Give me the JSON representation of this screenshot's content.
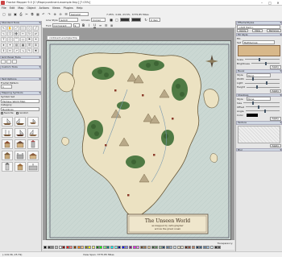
{
  "window": {
    "title": "Fractal Mapper 9.0 [C:\\Maps\\continent-example.fmp] [7.05%]",
    "minimize": "–",
    "maximize": "□",
    "close": "✕"
  },
  "menu": [
    "File",
    "Edit",
    "Map",
    "Object",
    "Actions",
    "Views",
    "Plugins",
    "Help"
  ],
  "toolbar": {
    "layer_select": "General",
    "zoom": "7.05%",
    "coords": "0.06, 23.5%",
    "distance": "3775.85 Miles",
    "line_style_label": "Line Style",
    "line_style_value": "(solid)",
    "arrows_label": "Arrows:",
    "arrows_value": "(none)",
    "font_label": "Font",
    "font_value": "Cormorant",
    "size_value": "9",
    "angle_value": "0 deg",
    "transparency_label": "Transparency:"
  },
  "left_panel": {
    "standard_tools": "Standard Tools",
    "tools": [
      "↖",
      "✋",
      "⤢",
      "⬜",
      "○",
      "╱",
      "∿",
      "⎔",
      "➕",
      "✂",
      "↻",
      "⇄",
      "T",
      "⬡",
      "⌒",
      "◇",
      "⚑",
      "☀",
      "★",
      "✦",
      "▧",
      "▩",
      "☰",
      "⊞",
      "⇕",
      "⇔",
      "↗",
      "↘",
      "✎",
      "✖"
    ],
    "grid_panel": "Grid Panel Tools",
    "custom_tools": "Custom Tools",
    "text_options": "Text Options",
    "fractal_pattern": "Fractal Pattern",
    "fractal_value": "1",
    "mapping_symbols": "Mapping Symbols",
    "symbol_set_label": "Symbol Set",
    "symbol_set": "Fantasy World Map",
    "category_label": "Category",
    "category": "Buildings",
    "favorite_label": "favorite",
    "random_label": "random"
  },
  "document": {
    "tab": "continent-example.fmp",
    "legend_title": "The Unseen World",
    "legend_sub1": "as mapped by cartographer",
    "legend_sub2": "across the great ocean"
  },
  "right_panel": {
    "effects_styles": "Effects/Styles",
    "effect_value": "<Add Item>",
    "apply": "Apply",
    "new": "New",
    "remove": "Remove",
    "fill_style": "Fill Style",
    "fill_label": "Fill:",
    "fill_value": "Bathtemap",
    "set_label": "Set",
    "scale_label": "Scale",
    "brightness_label": "Brightness",
    "bevel_label": "Bevel",
    "style_label": "Style",
    "style_value": "None",
    "width_label": "Width",
    "light_label": "Light",
    "height_label": "Height",
    "shadows_label": "Shadows",
    "shadow_style": "None",
    "size_label": "Size",
    "offset_label": "Offset",
    "angle_label": "Angle",
    "color_label": "Color",
    "texture_label": "Texture",
    "blur_label": "Blur"
  },
  "status": {
    "coords": "(-119.36, 25.79)",
    "view_span": "View Span: 3775.85 Miles"
  },
  "palette_colors": [
    "#000000",
    "#404040",
    "#808080",
    "#c0c0c0",
    "#ffffff",
    "#800000",
    "#ff0000",
    "#ff8080",
    "#804000",
    "#ff8000",
    "#ffc080",
    "#808000",
    "#ffff00",
    "#ffff80",
    "#008000",
    "#00ff00",
    "#80ff80",
    "#008080",
    "#00ffff",
    "#80ffff",
    "#000080",
    "#0000ff",
    "#8080ff",
    "#800080",
    "#ff00ff",
    "#ff80ff",
    "#6b4a2a",
    "#a07850",
    "#d8c090",
    "#3a5a3a",
    "#5a8a5a",
    "#9ac09a",
    "#2a4a6a",
    "#5a7a9a",
    "#9ab0c8",
    "#c8d8e0",
    "#e8e0c8",
    "#f0e8d0",
    "#603020",
    "#905040",
    "#c08060",
    "#204060",
    "#406080",
    "#6080a0",
    "#a0c0e0",
    "#e0f0ff",
    "#303030",
    "#505050"
  ]
}
